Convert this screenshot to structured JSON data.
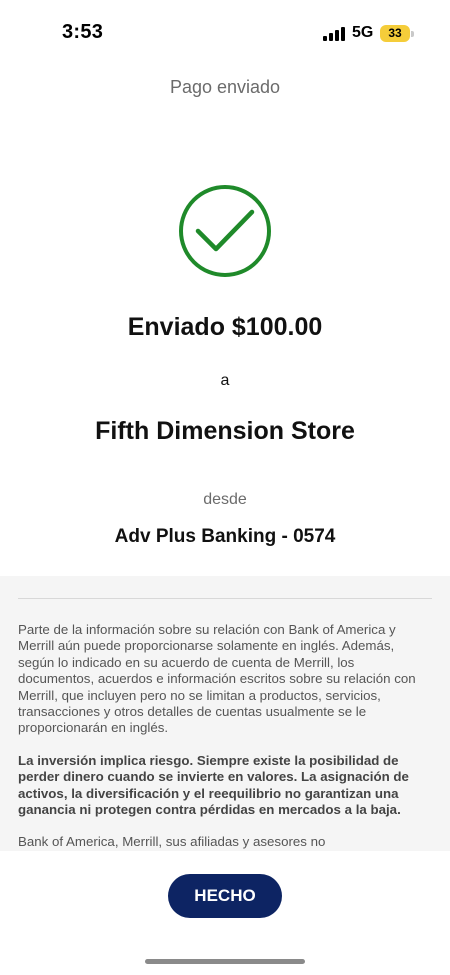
{
  "status_bar": {
    "time": "3:53",
    "network": "5G",
    "battery": "33"
  },
  "header": {
    "title": "Pago enviado"
  },
  "confirmation": {
    "icon": "checkmark-circle-icon",
    "sent_line": "Enviado $100.00",
    "to_word": "a",
    "recipient": "Fifth Dimension Store",
    "from_word": "desde",
    "account": "Adv Plus Banking - 0574"
  },
  "disclosure": {
    "paragraph_1": "Parte de la información sobre su relación con Bank of America y Merrill aún puede proporcionarse solamente en inglés. Además, según lo indicado en su acuerdo de cuenta de Merrill, los documentos, acuerdos e información escritos sobre su relación con Merrill, que incluyen pero no se limitan a productos, servicios, transacciones y otros detalles de cuentas usualmente se le proporcionarán en inglés.",
    "paragraph_2": "La inversión implica riesgo. Siempre existe la posibilidad de perder dinero cuando se invierte en valores. La asignación de activos, la diversificación y el reequilibrio no garantizan una ganancia ni protegen contra pérdidas en mercados a la baja.",
    "paragraph_3": "Bank of America, Merrill, sus afiliadas y asesores no"
  },
  "footer": {
    "done_label": "HECHO"
  },
  "colors": {
    "check_green": "#1f8a2a",
    "button_navy": "#0d2463",
    "battery_yellow": "#f5cd3a"
  }
}
